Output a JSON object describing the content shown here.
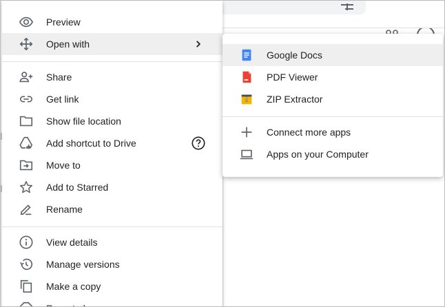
{
  "menu": {
    "items": [
      {
        "label": "Preview",
        "icon": "eye-icon"
      },
      {
        "label": "Open with",
        "icon": "move-arrows-icon",
        "submenu": true
      },
      {
        "label": "Share",
        "icon": "person-add-icon"
      },
      {
        "label": "Get link",
        "icon": "link-icon"
      },
      {
        "label": "Show file location",
        "icon": "folder-icon"
      },
      {
        "label": "Add shortcut to Drive",
        "icon": "drive-shortcut-icon"
      },
      {
        "label": "Move to",
        "icon": "move-to-folder-icon"
      },
      {
        "label": "Add to Starred",
        "icon": "star-icon"
      },
      {
        "label": "Rename",
        "icon": "pencil-icon"
      },
      {
        "label": "View details",
        "icon": "info-icon"
      },
      {
        "label": "Manage versions",
        "icon": "history-icon"
      },
      {
        "label": "Make a copy",
        "icon": "copy-icon"
      },
      {
        "label": "Report abuse",
        "icon": "report-icon"
      }
    ]
  },
  "submenu": {
    "items": [
      {
        "label": "Google Docs",
        "icon": "google-docs-icon"
      },
      {
        "label": "PDF Viewer",
        "icon": "pdf-viewer-icon"
      },
      {
        "label": "ZIP Extractor",
        "icon": "zip-extractor-icon"
      },
      {
        "label": "Connect more apps",
        "icon": "plus-icon"
      },
      {
        "label": "Apps on your Computer",
        "icon": "laptop-icon"
      }
    ]
  },
  "colors": {
    "highlight": "#efefef",
    "text": "#202124",
    "icon": "#5f6368",
    "docs_blue": "#4285f4",
    "pdf_red": "#ea4335",
    "zip_yellow": "#f4b400"
  }
}
